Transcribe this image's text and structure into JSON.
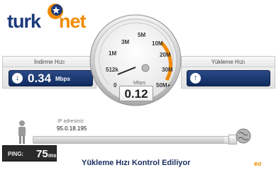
{
  "brand": {
    "part1": "turk",
    "part2": "net"
  },
  "download": {
    "label": "İndirme Hızı",
    "value": "0.34",
    "unit": "Mbps"
  },
  "upload": {
    "label": "Yükleme Hızı"
  },
  "gauge": {
    "ticks": [
      "0",
      "512k",
      "1M",
      "3M",
      "5M",
      "10M",
      "20M",
      "30M",
      "50M+"
    ],
    "unit": "Mbps",
    "reading": "0.12"
  },
  "connection": {
    "ip_label": "IP adresiniz:",
    "ip_value": "95.0.18.195"
  },
  "ping": {
    "label": "PING:",
    "value": "75",
    "unit": "ms"
  },
  "status": "Yükleme Hızı Kontrol Ediliyor",
  "colors": {
    "accent": "#f08a00",
    "navy": "#1b3a7a"
  }
}
